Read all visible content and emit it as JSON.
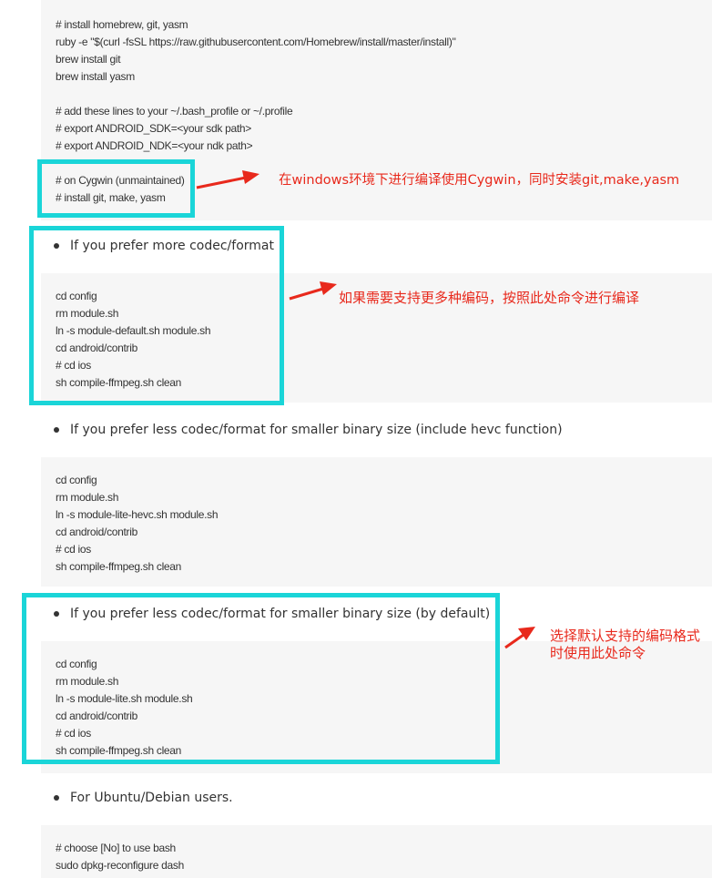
{
  "block1": {
    "lines": [
      "# install homebrew, git, yasm",
      "ruby -e \"$(curl -fsSL https://raw.githubusercontent.com/Homebrew/install/master/install)\"",
      "brew install git",
      "brew install yasm",
      "",
      "# add these lines to your ~/.bash_profile or ~/.profile",
      "# export ANDROID_SDK=<your sdk path>",
      "# export ANDROID_NDK=<your ndk path>",
      "",
      "# on Cygwin (unmaintained)",
      "# install git, make, yasm"
    ]
  },
  "bullet1": "If you prefer more codec/format",
  "block2": {
    "lines": [
      "cd config",
      "rm module.sh",
      "ln -s module-default.sh module.sh",
      "cd android/contrib",
      "# cd ios",
      "sh compile-ffmpeg.sh clean"
    ]
  },
  "bullet2": "If you prefer less codec/format for smaller binary size (include hevc function)",
  "block3": {
    "lines": [
      "cd config",
      "rm module.sh",
      "ln -s module-lite-hevc.sh module.sh",
      "cd android/contrib",
      "# cd ios",
      "sh compile-ffmpeg.sh clean"
    ]
  },
  "bullet3": "If you prefer less codec/format for smaller binary size (by default)",
  "block4": {
    "lines": [
      "cd config",
      "rm module.sh",
      "ln -s module-lite.sh module.sh",
      "cd android/contrib",
      "# cd ios",
      "sh compile-ffmpeg.sh clean"
    ]
  },
  "bullet4": "For Ubuntu/Debian users.",
  "block5": {
    "lines": [
      "# choose [No] to use bash",
      "sudo dpkg-reconfigure dash"
    ]
  },
  "annotations": {
    "note1": "在windows环境下进行编译使用Cygwin，同时安装git,make,yasm",
    "note2": "如果需要支持更多种编码，按照此处命令进行编译",
    "note3_line1": "选择默认支持的编码格式",
    "note3_line2": "时使用此处命令"
  },
  "colors": {
    "highlight": "#1ad5d8",
    "annotation": "#e8291c",
    "code_bg": "#f6f6f6"
  }
}
